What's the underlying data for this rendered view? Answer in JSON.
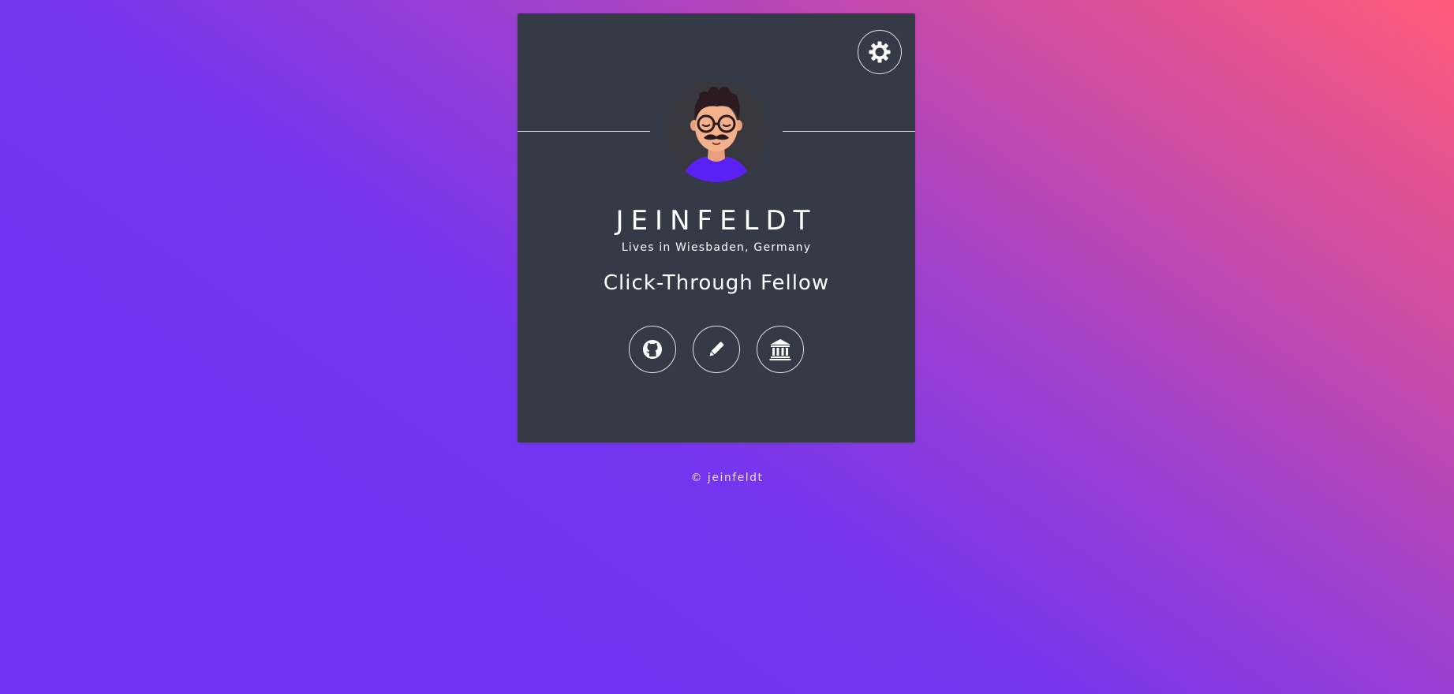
{
  "profile": {
    "name": "JEINFELDT",
    "location": "Lives in Wiesbaden, Germany",
    "tagline": "Click-Through Fellow"
  },
  "icons": {
    "settings": "gear-icon",
    "github": "github-icon",
    "blog": "pencil-icon",
    "institution": "bank-icon"
  },
  "footer": {
    "copyright": "© jeinfeldt"
  },
  "colors": {
    "card": "#343a46",
    "gradient_top_right": "#ff5b79",
    "gradient_bottom_left": "#6e33f3",
    "avatar_shirt": "#5b20f4"
  }
}
